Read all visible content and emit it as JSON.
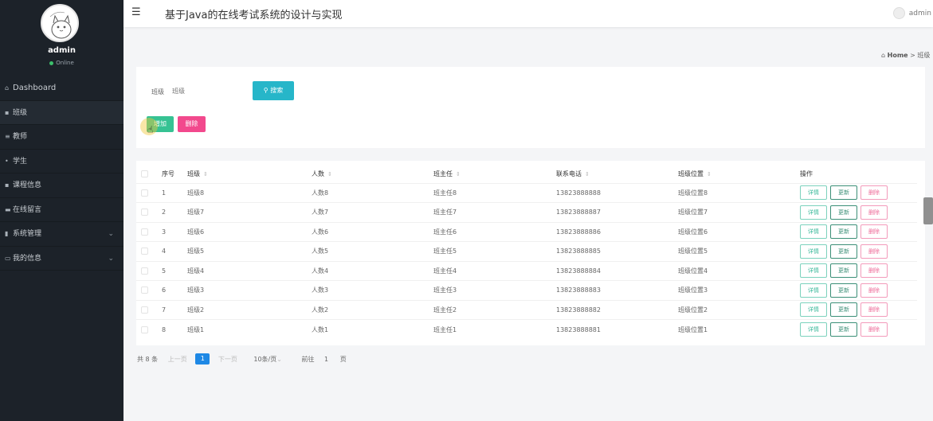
{
  "sidebar": {
    "username": "admin",
    "status": "Online",
    "items": [
      {
        "label": "Dashboard",
        "icon": "home-icon"
      },
      {
        "label": "班级",
        "icon": "grid-icon"
      },
      {
        "label": "教师",
        "icon": "list-icon"
      },
      {
        "label": "学生",
        "icon": "users-icon"
      },
      {
        "label": "课程信息",
        "icon": "grid-icon"
      },
      {
        "label": "在线留言",
        "icon": "chat-icon"
      },
      {
        "label": "系统管理",
        "icon": "bar-chart-icon"
      },
      {
        "label": "我的信息",
        "icon": "card-icon"
      }
    ]
  },
  "header": {
    "title": "基于Java的在线考试系统的设计与实现",
    "user": "admin"
  },
  "breadcrumb": {
    "home": "Home",
    "separator": ">",
    "current": "班级"
  },
  "search": {
    "label": "班级",
    "placeholder": "班级",
    "button": "搜索"
  },
  "actions": {
    "add": "增加",
    "delete": "删除"
  },
  "table": {
    "headers": [
      "序号",
      "班级",
      "人数",
      "班主任",
      "联系电话",
      "班级位置",
      "操作"
    ],
    "row_buttons": {
      "detail": "详情",
      "update": "更新",
      "remove": "删除"
    },
    "rows": [
      {
        "no": "1",
        "class": "班级8",
        "count": "人数8",
        "teacher": "班主任8",
        "phone": "13823888888",
        "location": "班级位置8"
      },
      {
        "no": "2",
        "class": "班级7",
        "count": "人数7",
        "teacher": "班主任7",
        "phone": "13823888887",
        "location": "班级位置7"
      },
      {
        "no": "3",
        "class": "班级6",
        "count": "人数6",
        "teacher": "班主任6",
        "phone": "13823888886",
        "location": "班级位置6"
      },
      {
        "no": "4",
        "class": "班级5",
        "count": "人数5",
        "teacher": "班主任5",
        "phone": "13823888885",
        "location": "班级位置5"
      },
      {
        "no": "5",
        "class": "班级4",
        "count": "人数4",
        "teacher": "班主任4",
        "phone": "13823888884",
        "location": "班级位置4"
      },
      {
        "no": "6",
        "class": "班级3",
        "count": "人数3",
        "teacher": "班主任3",
        "phone": "13823888883",
        "location": "班级位置3"
      },
      {
        "no": "7",
        "class": "班级2",
        "count": "人数2",
        "teacher": "班主任2",
        "phone": "13823888882",
        "location": "班级位置2"
      },
      {
        "no": "8",
        "class": "班级1",
        "count": "人数1",
        "teacher": "班主任1",
        "phone": "13823888881",
        "location": "班级位置1"
      }
    ]
  },
  "pagination": {
    "total": "共 8 条",
    "prev": "上一页",
    "current": "1",
    "next": "下一页",
    "page_size": "10条/页",
    "goto_label": "前往",
    "goto_value": "1",
    "page_unit": "页"
  },
  "colors": {
    "sidebar_bg": "#1c2229",
    "search_button": "#26b6c9",
    "add_button": "#36c293",
    "delete_button": "#f2498d",
    "current_page": "#1e88e5"
  }
}
